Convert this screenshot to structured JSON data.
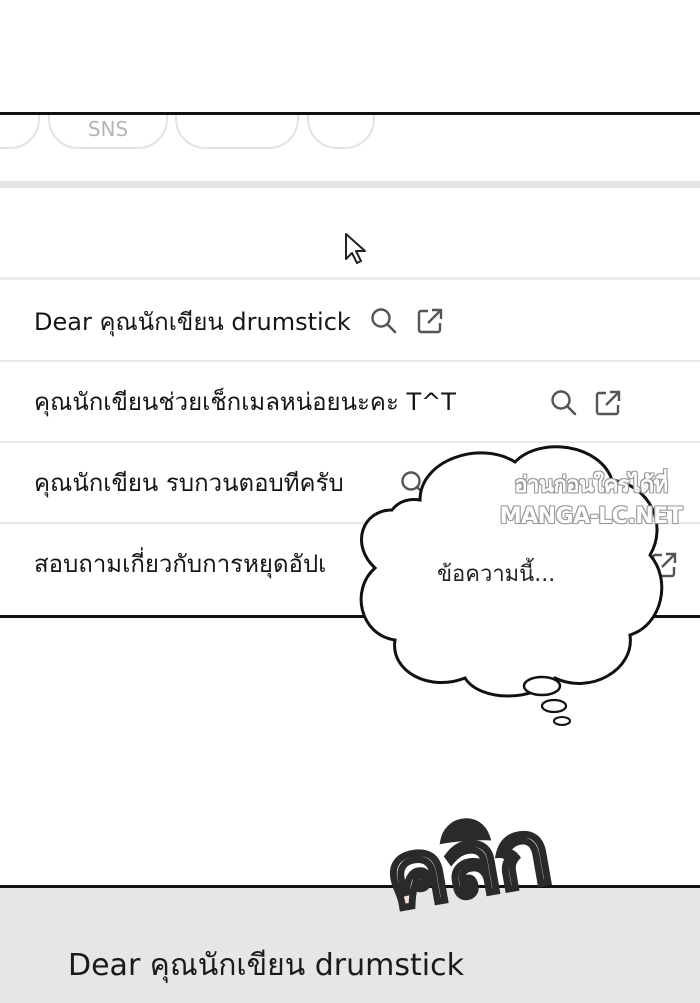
{
  "chips": [
    "",
    "SNS",
    "",
    ""
  ],
  "mail_list": [
    {
      "title": "Dear คุณนักเขียน drumstick"
    },
    {
      "title": "คุณนักเขียนช่วยเช็กเมลหน่อยนะคะ T^T"
    },
    {
      "title": "คุณนักเขียน รบกวนตอบทีครับ"
    },
    {
      "title": "สอบถามเกี่ยวกับการหยุดอัปเ"
    }
  ],
  "thought": {
    "text": "ข้อความนี้..."
  },
  "watermark": {
    "line1": "อ่านก่อนใครได้ที่",
    "line2": "MANGA-LC.NET"
  },
  "sound_effect": {
    "text": "คลิก"
  },
  "bottom_panel": {
    "title": "Dear คุณนักเขียน drumstick"
  },
  "colors": {
    "ink": "#111111",
    "divider": "#e4e4e4",
    "bottom_bg": "#e6e6e9",
    "sfx_fill": "#f3dede"
  },
  "icons": [
    "search-icon",
    "open-external-icon",
    "mouse-cursor-icon"
  ]
}
